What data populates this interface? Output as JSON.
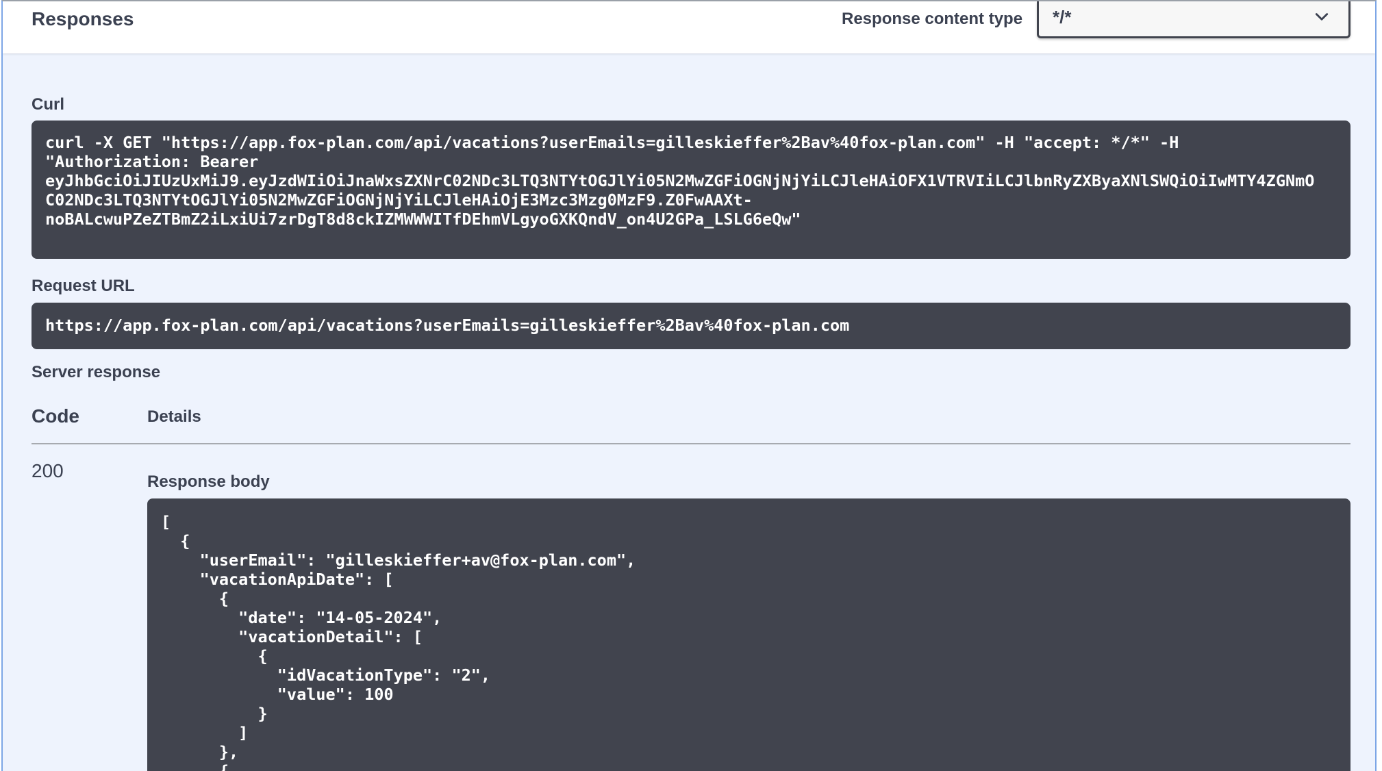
{
  "responses": {
    "title": "Responses",
    "content_type_label": "Response content type",
    "content_type_value": "*/*"
  },
  "curl": {
    "label": "Curl",
    "command": "curl -X GET \"https://app.fox-plan.com/api/vacations?userEmails=gilleskieffer%2Bav%40fox-plan.com\" -H \"accept: */*\" -H\n\"Authorization: Bearer\neyJhbGciOiJIUzUxMiJ9.eyJzdWIiOiJnaWxsZXNrC02NDc3LTQ3NTYtOGJlYi05N2MwZGFiOGNjNjYiLCJleHAiOFX1VTRVIiLCJlbnRyZXByaXNlSWQiOiIwMTY4ZGNmO\nC02NDc3LTQ3NTYtOGJlYi05N2MwZGFiOGNjNjYiLCJleHAiOjE3Mzc3Mzg0MzF9.Z0FwAAXt-\nnoBALcwuPZeZTBmZ2iLxiUi7zrDgT8d8ckIZMWWWITfDEhmVLgyoGXKQndV_on4U2GPa_LSLG6eQw\""
  },
  "request_url": {
    "label": "Request URL",
    "value": "https://app.fox-plan.com/api/vacations?userEmails=gilleskieffer%2Bav%40fox-plan.com"
  },
  "server_response": {
    "label": "Server response",
    "col_code": "Code",
    "col_details": "Details",
    "status_code": "200",
    "body_label": "Response body",
    "body": "[\n  {\n    \"userEmail\": \"gilleskieffer+av@fox-plan.com\",\n    \"vacationApiDate\": [\n      {\n        \"date\": \"14-05-2024\",\n        \"vacationDetail\": [\n          {\n            \"idVacationType\": \"2\",\n            \"value\": 100\n          }\n        ]\n      },\n      {"
  }
}
